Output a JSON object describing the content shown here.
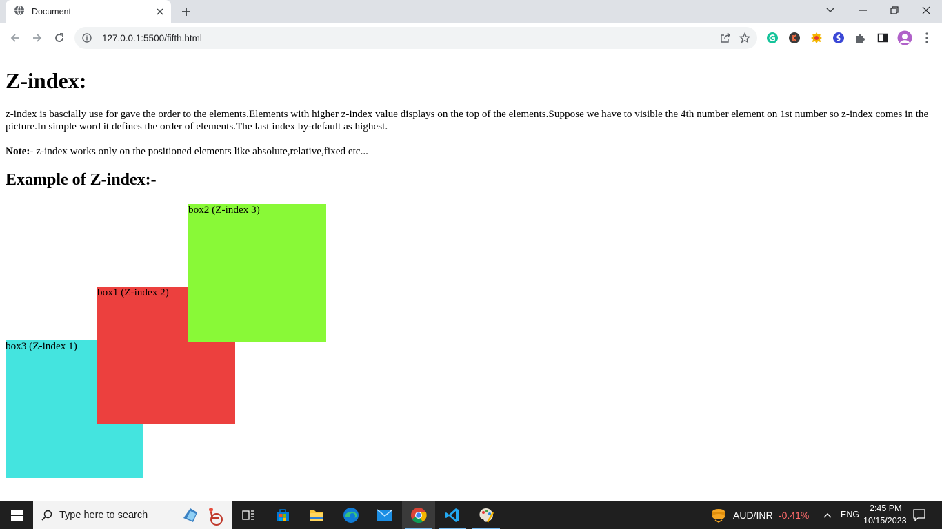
{
  "browser": {
    "tab_title": "Document",
    "new_tab_label": "+",
    "url": "127.0.0.1:5500/fifth.html"
  },
  "page": {
    "heading": "Z-index:",
    "paragraph": "z-index is bascially use for gave the order to the elements.Elements with higher z-index value displays on the top of the elements.Suppose we have to visible the 4th number element on 1st number so z-index comes in the picture.In simple word it defines the order of elements.The last index by-default as highest.",
    "note_label": "Note:",
    "note_text": "- z-index works only on the positioned elements like absolute,relative,fixed etc...",
    "example_heading": "Example of Z-index:-",
    "boxes": {
      "box3": {
        "label": "box3 (Z-index 1)",
        "color": "#44e4df"
      },
      "box1": {
        "label": "box1 (Z-index 2)",
        "color": "#ec403e"
      },
      "box2": {
        "label": "box2 (Z-index 3)",
        "color": "#89f937"
      }
    }
  },
  "taskbar": {
    "search_placeholder": "Type here to search",
    "ticker_symbol": "AUD/INR",
    "ticker_change": "-0.41%",
    "language": "ENG",
    "time": "2:45 PM",
    "date": "10/15/2023"
  },
  "colors": {
    "tabstrip_bg": "#dee1e6",
    "taskbar_bg": "#1f1f1f",
    "ticker_negative": "#ff6b6b"
  }
}
